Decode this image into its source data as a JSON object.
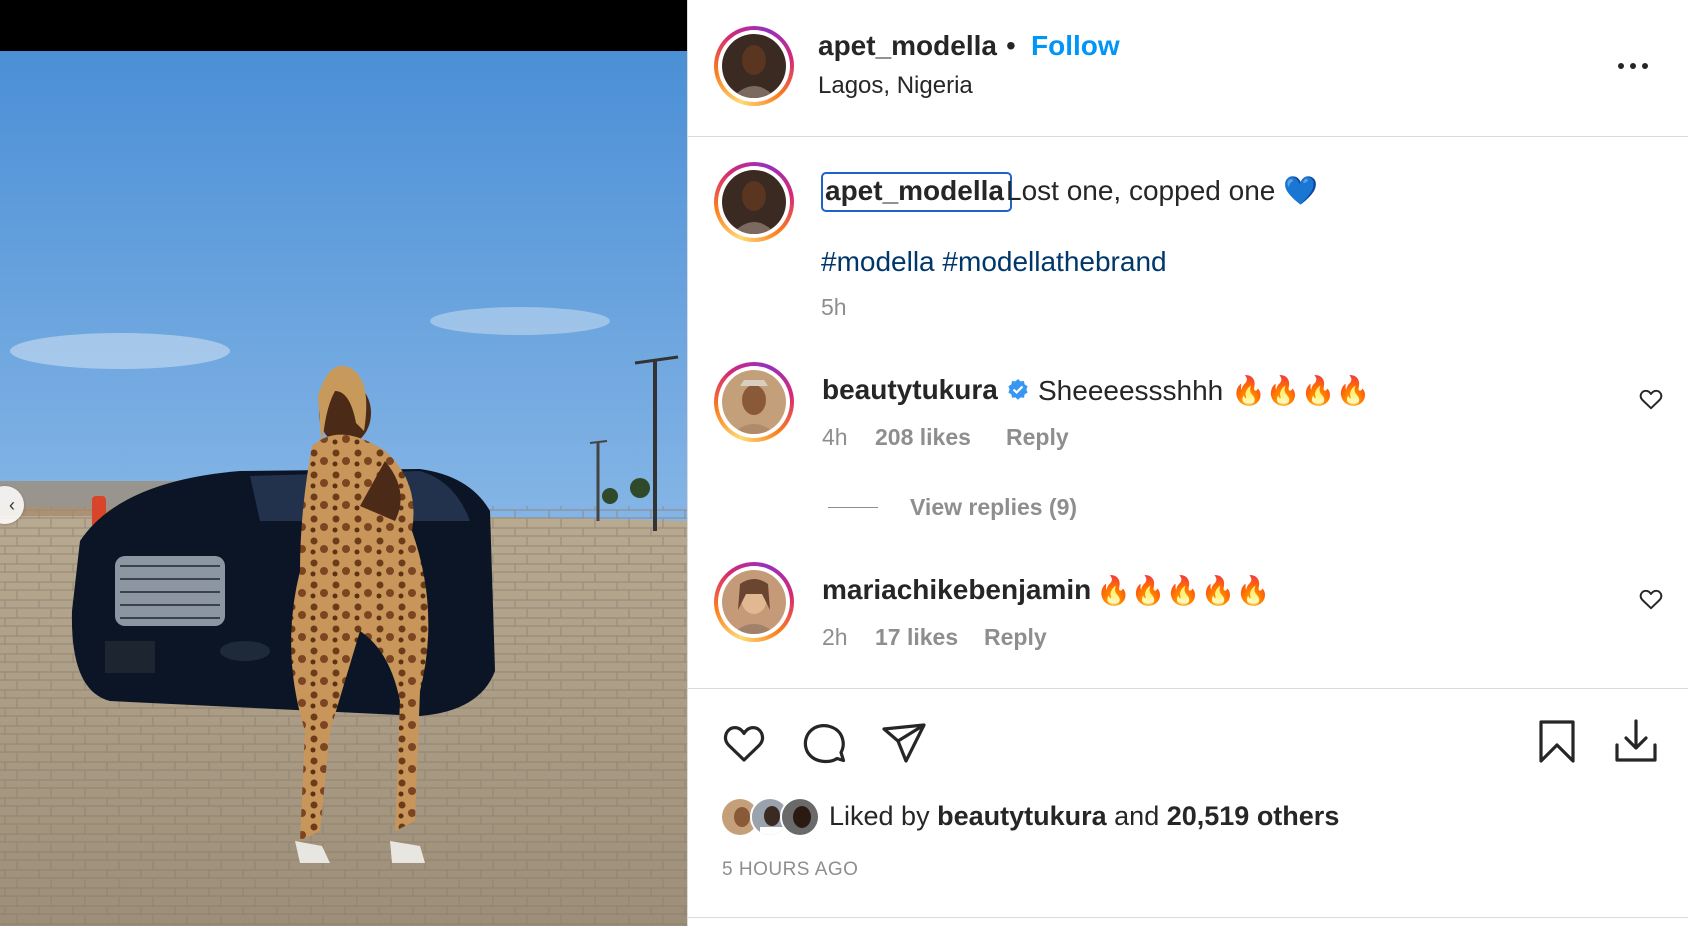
{
  "post": {
    "author": "apet_modella",
    "separator": "•",
    "follow_label": "Follow",
    "location": "Lagos, Nigeria"
  },
  "caption": {
    "username": "apet_modella",
    "text": "Lost one, copped one 💙",
    "hashtags": [
      "#modella",
      "#modellathebrand"
    ],
    "time": "5h"
  },
  "comments": [
    {
      "username": "beautytukura",
      "verified": true,
      "text": "Sheeeessshhh 🔥🔥🔥🔥",
      "time": "4h",
      "likes": "208 likes",
      "reply_label": "Reply",
      "view_replies": "View replies (9)"
    },
    {
      "username": "mariachikebenjamin",
      "verified": false,
      "text": "🔥🔥🔥🔥🔥",
      "time": "2h",
      "likes": "17 likes",
      "reply_label": "Reply"
    }
  ],
  "likes": {
    "prefix": "Liked by",
    "user": "beautytukura",
    "conjunction": "and",
    "others": "20,519 others"
  },
  "timestamp": "5 HOURS AGO",
  "colors": {
    "link": "#0095f6",
    "hashtag": "#00376b",
    "muted": "#8e8e8e",
    "verified": "#3897f0"
  },
  "icons": [
    "prev-arrow-icon",
    "more-options-icon",
    "verified-icon",
    "heart-icon",
    "like-icon",
    "comment-icon",
    "share-icon",
    "bookmark-icon",
    "download-icon"
  ]
}
